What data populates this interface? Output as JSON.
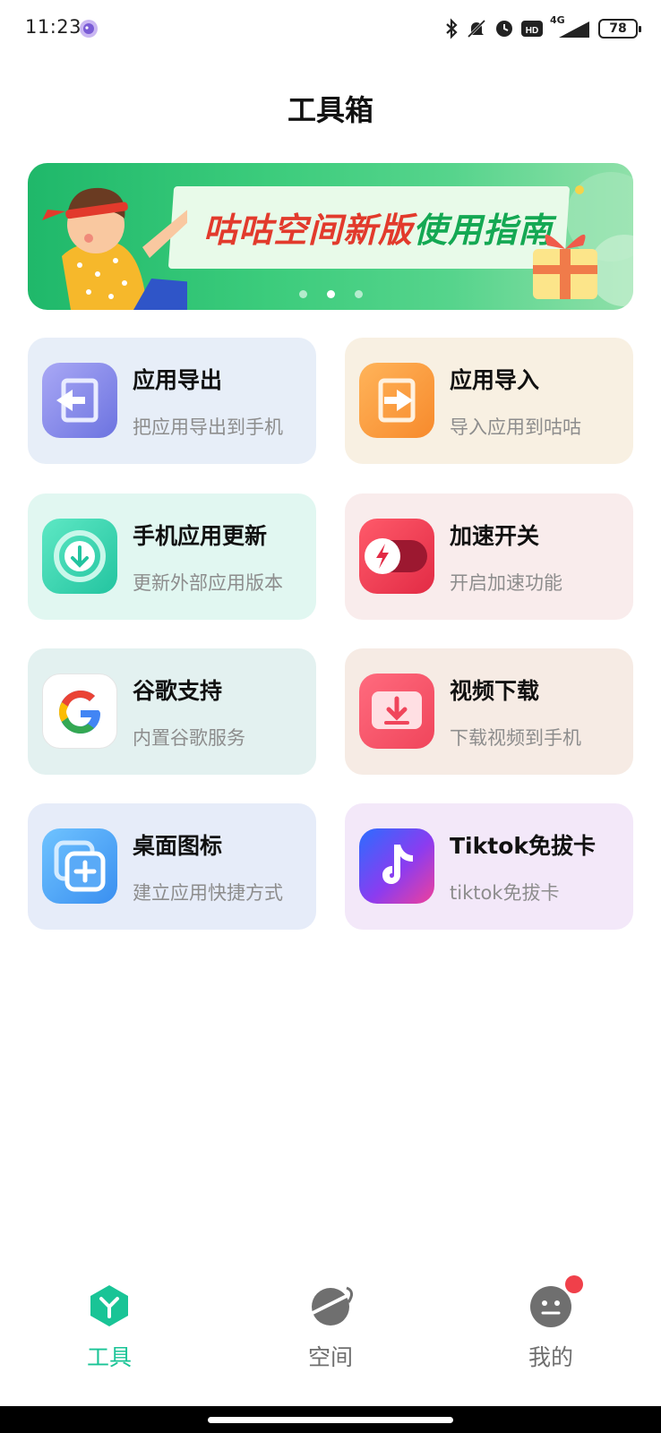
{
  "status_bar": {
    "time": "11:23",
    "network": "4G",
    "battery": "78"
  },
  "header": {
    "title": "工具箱"
  },
  "banner": {
    "slogan_part1": "咕咕空间新版",
    "slogan_part2": "使用指南",
    "page_count": 3,
    "active_page": 2
  },
  "tools": [
    {
      "title": "应用导出",
      "subtitle": "把应用导出到手机",
      "icon": "export-icon"
    },
    {
      "title": "应用导入",
      "subtitle": "导入应用到咕咕",
      "icon": "import-icon"
    },
    {
      "title": "手机应用更新",
      "subtitle": "更新外部应用版本",
      "icon": "update-icon"
    },
    {
      "title": "加速开关",
      "subtitle": "开启加速功能",
      "icon": "accelerate-toggle-icon"
    },
    {
      "title": "谷歌支持",
      "subtitle": "内置谷歌服务",
      "icon": "google-icon"
    },
    {
      "title": "视频下载",
      "subtitle": "下载视频到手机",
      "icon": "video-download-icon"
    },
    {
      "title": "桌面图标",
      "subtitle": "建立应用快捷方式",
      "icon": "desktop-shortcut-icon"
    },
    {
      "title": "Tiktok免拔卡",
      "subtitle": "tiktok免拔卡",
      "icon": "tiktok-icon"
    }
  ],
  "bottom_nav": {
    "items": [
      {
        "label": "工具",
        "icon": "tools-icon",
        "active": true
      },
      {
        "label": "空间",
        "icon": "planet-icon",
        "active": false
      },
      {
        "label": "我的",
        "icon": "profile-icon",
        "active": false,
        "badge": true
      }
    ]
  },
  "colors": {
    "accent": "#19c496",
    "badge": "#f0404a",
    "banner_green": "#3ccc7c"
  }
}
